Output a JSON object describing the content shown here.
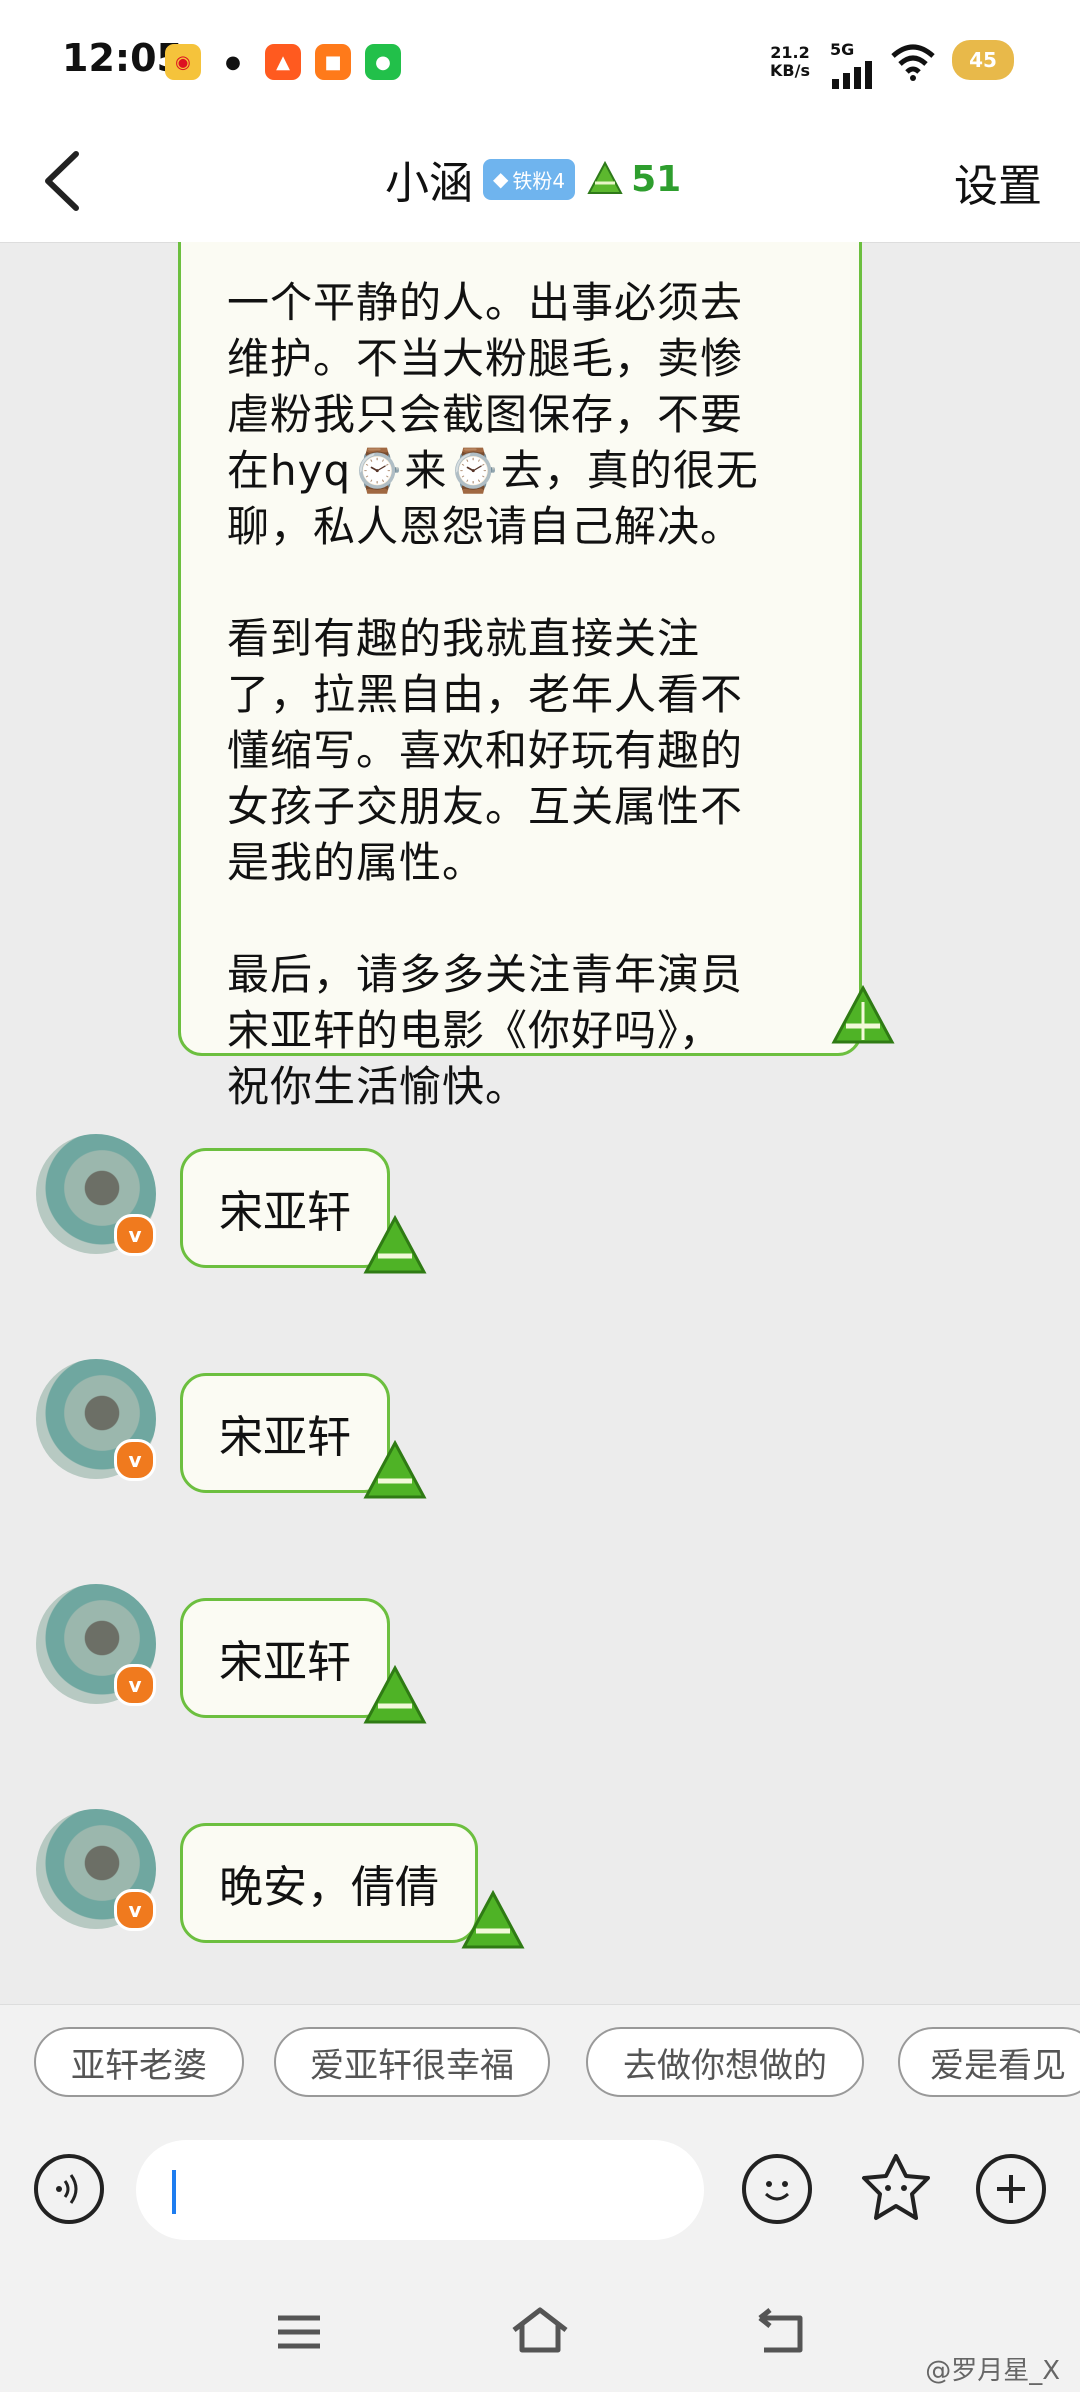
{
  "status_bar": {
    "time": "12:05",
    "network_speed_value": "21.2",
    "network_speed_unit": "KB/s",
    "signal_label": "5G",
    "battery": "45"
  },
  "header": {
    "title": "小涵",
    "fan_badge": "铁粉4",
    "leaf_count": "51",
    "settings_label": "设置"
  },
  "messages": {
    "long_text": "一个平静的人。出事必须去\n维护。不当大粉腿毛，卖惨\n虐粉我只会截图保存，不要\n在hyq⌚来⌚去，真的很无\n聊，私人恩怨请自己解决。\n\n看到有趣的我就直接关注\n了，拉黑自由，老年人看不\n懂缩写。喜欢和好玩有趣的\n女孩子交朋友。互关属性不\n是我的属性。\n\n最后，请多多关注青年演员\n宋亚轩的电影《你好吗》，\n祝你生活愉快。",
    "items": [
      {
        "text": "宋亚轩"
      },
      {
        "text": "宋亚轩"
      },
      {
        "text": "宋亚轩"
      },
      {
        "text": "晚安，倩倩"
      }
    ]
  },
  "quick_replies": [
    "亚轩老婆",
    "爱亚轩很幸福",
    "去做你想做的",
    "爱是看见"
  ],
  "watermark": "@罗月星_X",
  "colors": {
    "bubble_border": "#6cbf3f",
    "bubble_fill": "#fbfbf3",
    "accent_orange": "#f07a1e",
    "fan_badge": "#6fb4ee",
    "caret": "#1e7df0"
  }
}
